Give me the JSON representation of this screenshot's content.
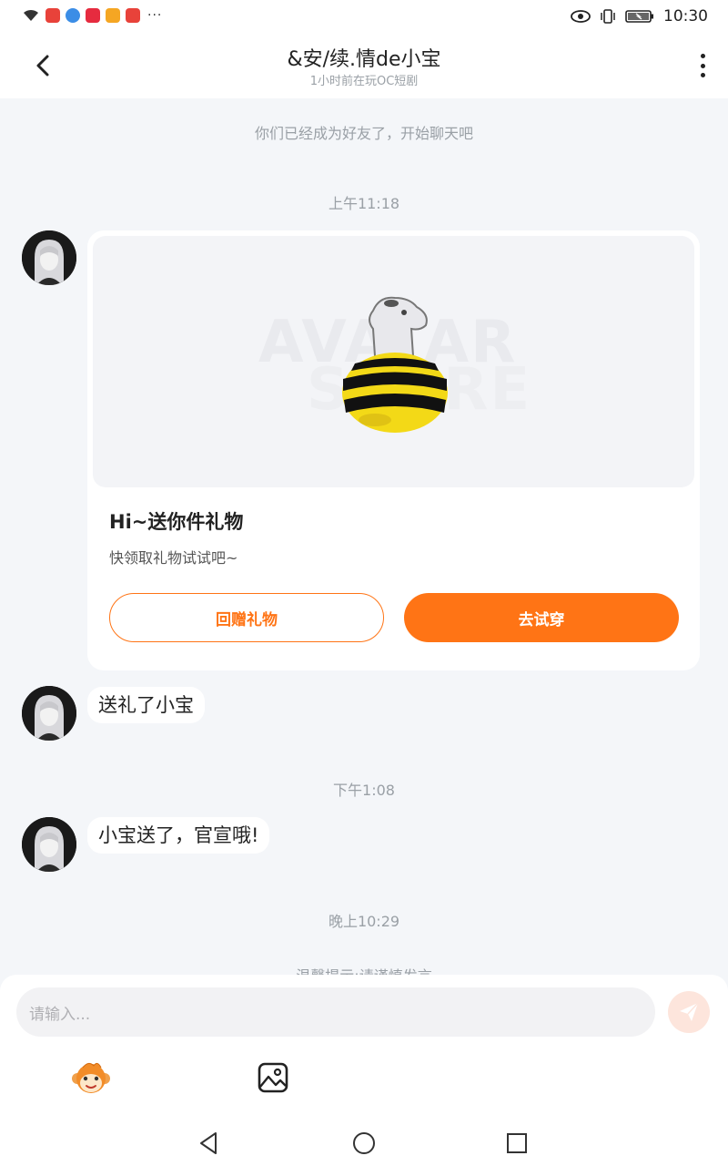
{
  "status_bar": {
    "time": "10:30",
    "more": "···"
  },
  "header": {
    "title": "&安/续.情de小宝",
    "subtitle": "1小时前在玩OC短剧"
  },
  "messages": {
    "friend_notice": "你们已经成为好友了，开始聊天吧",
    "time_1": "上午11:18",
    "time_2": "下午1:08",
    "time_3": "晚上10:29",
    "tip_partial": "温馨提示:请谨慎发言"
  },
  "gift_card": {
    "title": "Hi~送你件礼物",
    "description": "快领取礼物试试吧~",
    "return_gift_label": "回赠礼物",
    "try_on_label": "去试穿",
    "watermark_line1": "AVATAR",
    "watermark_line2": "STORE"
  },
  "chat": {
    "bubble_1": "送礼了小宝",
    "bubble_2": "小宝送了，官宣哦!"
  },
  "composer": {
    "placeholder": "请输入..."
  },
  "colors": {
    "accent": "#ff7415",
    "send_disabled_bg": "#fde5dc",
    "background": "#f4f6f9"
  },
  "icons": {
    "back": "chevron-left-icon",
    "menu": "kebab-icon",
    "send": "paper-plane-icon",
    "sticker": "monkey-face-icon",
    "image": "image-icon",
    "nav_back": "triangle-back-icon",
    "nav_home": "circle-home-icon",
    "nav_recent": "square-recent-icon"
  }
}
